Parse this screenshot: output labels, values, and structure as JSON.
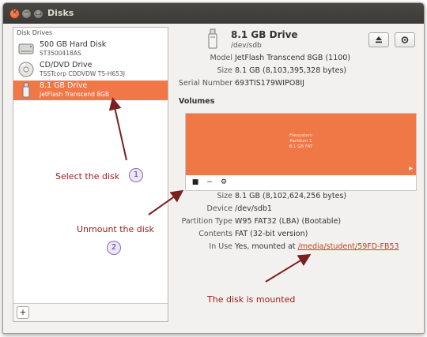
{
  "window": {
    "title": "Disks",
    "controls": {
      "close": "×",
      "minimize": "−",
      "maximize": "□"
    }
  },
  "sidebar": {
    "header": "Disk Drives",
    "drives": [
      {
        "name": "500 GB Hard Disk",
        "sub": "ST3500418AS",
        "icon": "hard-disk-icon",
        "selected": false
      },
      {
        "name": "CD/DVD Drive",
        "sub": "TSSTcorp CDDVDW TS-H653J",
        "icon": "optical-disc-icon",
        "selected": false
      },
      {
        "name": "8.1 GB Drive",
        "sub": "JetFlash Transcend 8GB",
        "icon": "usb-drive-icon",
        "selected": true
      }
    ],
    "add_button": "+"
  },
  "details": {
    "title": "8.1 GB Drive",
    "device": "/dev/sdb",
    "model_label": "Model",
    "model": "JetFlash Transcend 8GB (1100)",
    "size_label": "Size",
    "size": "8.1 GB (8,103,395,328 bytes)",
    "serial_label": "Serial Number",
    "serial": "693TIS179WIPO8IJ"
  },
  "volumes": {
    "header": "Volumes",
    "partition": {
      "line1": "Filesystem",
      "line2": "Partition 1",
      "line3": "8.1 GB FAT"
    },
    "tools": {
      "unmount": "■",
      "remove": "−",
      "settings": "⚙"
    },
    "size_label": "Size",
    "size": "8.1 GB (8,102,624,256 bytes)",
    "device_label": "Device",
    "device": "/dev/sdb1",
    "ptype_label": "Partition Type",
    "ptype": "W95 FAT32 (LBA) (Bootable)",
    "contents_label": "Contents",
    "contents": "FAT (32-bit version)",
    "inuse_label": "In Use",
    "inuse_prefix": "Yes, mounted at",
    "mount_path": "/media/student/59FD-FB53"
  },
  "annotations": {
    "select": "Select the disk",
    "select_num": "1",
    "unmount": "Unmount the disk",
    "unmount_num": "2",
    "mounted": "The disk is mounted"
  },
  "colors": {
    "accent": "#f07746",
    "annotation": "#9a1c1c",
    "badge": "#8c6bb5"
  }
}
